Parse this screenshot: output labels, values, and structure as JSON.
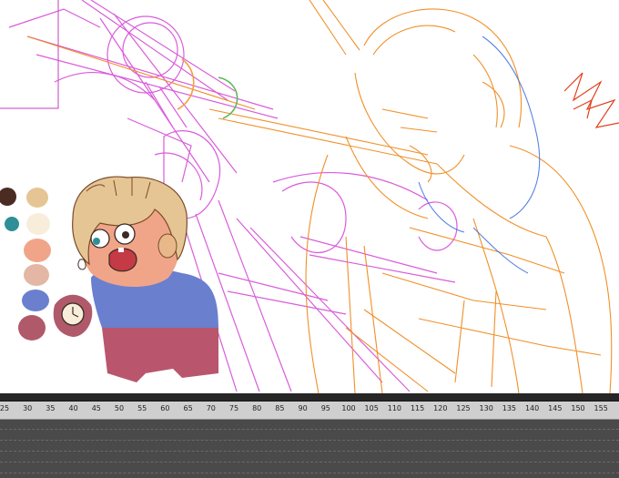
{
  "canvas": {
    "palette": [
      "#4b2c22",
      "#e6c594",
      "#2f8f96",
      "#f8eddb",
      "#f1a588",
      "#e3b7a4",
      "#6b7fcf",
      "#b0596a"
    ],
    "colors": {
      "magenta": "#d64bd8",
      "orange": "#f08a1e",
      "blue": "#3a6ee0",
      "red": "#e2401e",
      "green": "#5cb85c"
    }
  },
  "timeline": {
    "ruler_labels": [
      "25",
      "30",
      "35",
      "40",
      "45",
      "50",
      "55",
      "60",
      "65",
      "70",
      "75",
      "80",
      "85",
      "90",
      "95",
      "100",
      "105",
      "110",
      "115",
      "120",
      "125",
      "130",
      "135",
      "140",
      "145",
      "150",
      "155"
    ]
  }
}
